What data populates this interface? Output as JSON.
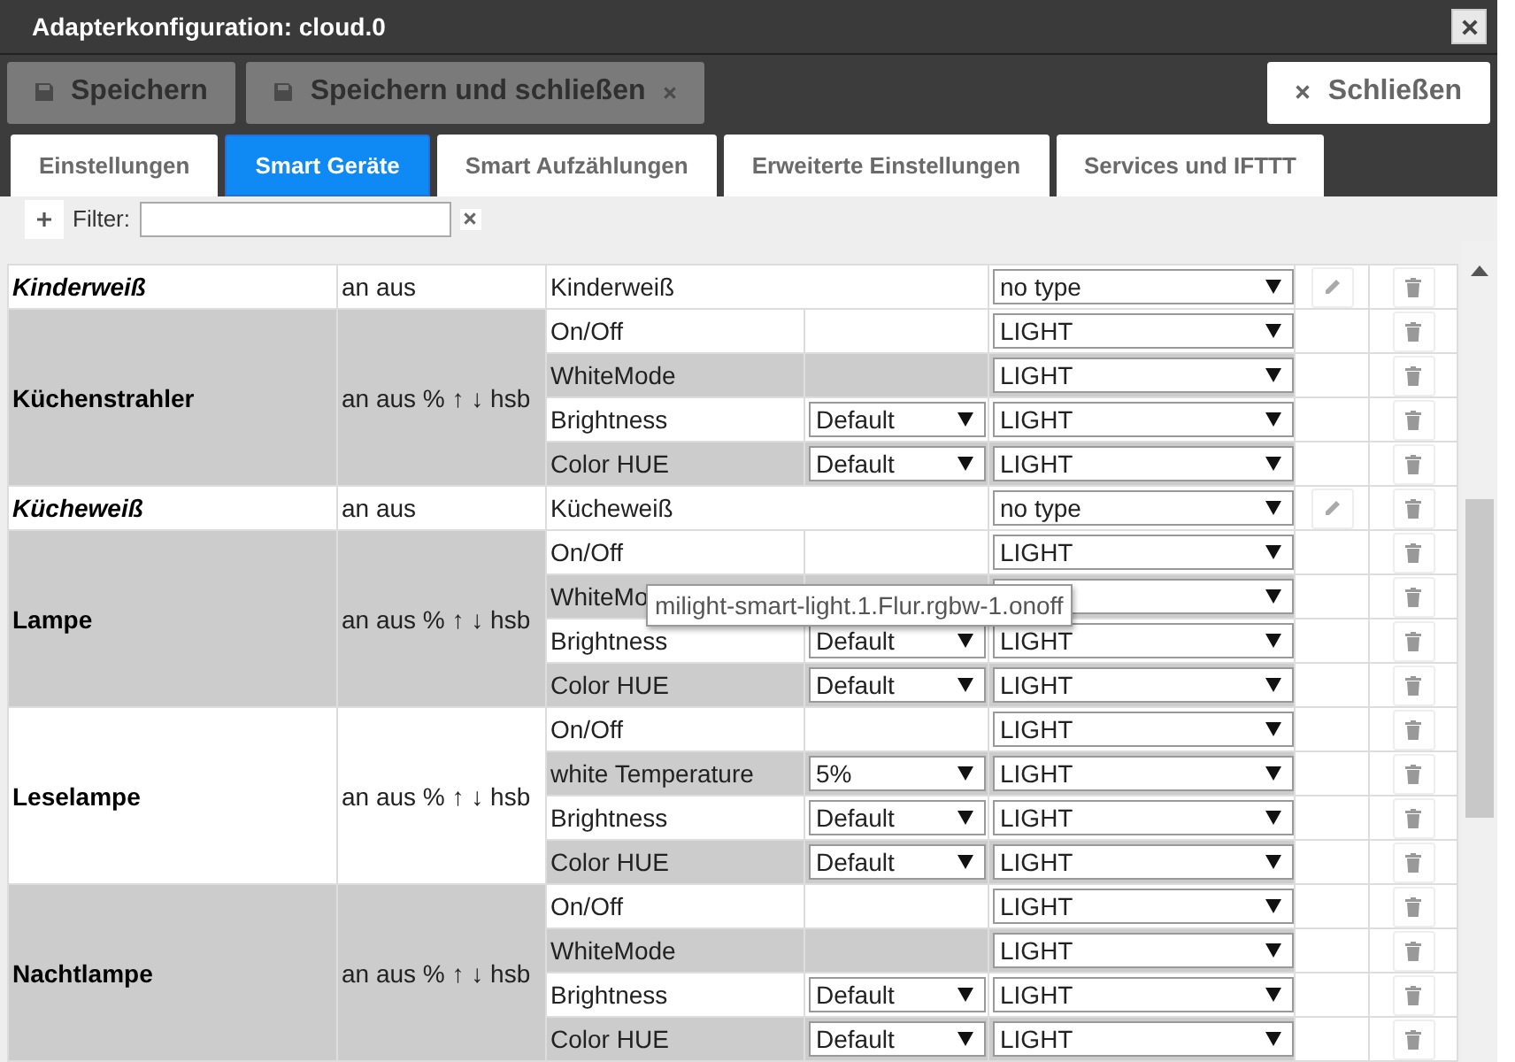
{
  "window": {
    "title": "Adapterkonfiguration: cloud.0"
  },
  "toolbar": [
    {
      "label": "Speichern",
      "kind": "save",
      "disabled": true
    },
    {
      "label": "Speichern und schließen",
      "kind": "save-close",
      "disabled": true
    },
    {
      "label": "Schließen",
      "kind": "close",
      "disabled": false
    }
  ],
  "tabs": [
    {
      "label": "Einstellungen",
      "selected": false
    },
    {
      "label": "Smart Geräte",
      "selected": true
    },
    {
      "label": "Smart Aufzählungen",
      "selected": false
    },
    {
      "label": "Erweiterte Einstellungen",
      "selected": false
    },
    {
      "label": "Services und IFTTT",
      "selected": false
    }
  ],
  "filter": {
    "label": "Filter:"
  },
  "devices": [
    {
      "name": "Kinderweiß",
      "kind": "single",
      "shaded": false,
      "types": "an aus",
      "states": [
        {
          "label": "Kinderweiß",
          "type": "no type"
        }
      ]
    },
    {
      "name": "Küchenstrahler",
      "kind": "group",
      "shaded": true,
      "types": "an aus % ↑ ↓ hsb",
      "states": [
        {
          "label": "On/Off",
          "type": "LIGHT"
        },
        {
          "label": "WhiteMode",
          "type": "LIGHT"
        },
        {
          "label": "Brightness",
          "option": "Default",
          "type": "LIGHT"
        },
        {
          "label": "Color HUE",
          "option": "Default",
          "type": "LIGHT"
        }
      ]
    },
    {
      "name": "Kücheweiß",
      "kind": "single",
      "shaded": false,
      "types": "an aus",
      "states": [
        {
          "label": "Kücheweiß",
          "type": "no type"
        }
      ]
    },
    {
      "name": "Lampe",
      "kind": "group",
      "shaded": true,
      "types": "an aus % ↑ ↓ hsb",
      "states": [
        {
          "label": "On/Off",
          "type": "LIGHT"
        },
        {
          "label": "WhiteMo"
        },
        {
          "label": "Brightness",
          "option": "Default",
          "type": "LIGHT"
        },
        {
          "label": "Color HUE",
          "option": "Default",
          "type": "LIGHT"
        }
      ]
    },
    {
      "name": "Leselampe",
      "kind": "group",
      "shaded": false,
      "types": "an aus % ↑ ↓ hsb",
      "states": [
        {
          "label": "On/Off",
          "type": "LIGHT"
        },
        {
          "label": "white Temperature",
          "option": "5%",
          "type": "LIGHT"
        },
        {
          "label": "Brightness",
          "option": "Default",
          "type": "LIGHT"
        },
        {
          "label": "Color HUE",
          "option": "Default",
          "type": "LIGHT"
        }
      ]
    },
    {
      "name": "Nachtlampe",
      "kind": "group",
      "shaded": true,
      "types": "an aus % ↑ ↓ hsb",
      "states": [
        {
          "label": "On/Off",
          "type": "LIGHT"
        },
        {
          "label": "WhiteMode",
          "type": "LIGHT"
        },
        {
          "label": "Brightness",
          "option": "Default",
          "type": "LIGHT"
        },
        {
          "label": "Color HUE",
          "option": "Default",
          "type": "LIGHT"
        }
      ]
    }
  ],
  "tooltip": {
    "text": "milight-smart-light.1.Flur.rgbw-1.onoff"
  }
}
